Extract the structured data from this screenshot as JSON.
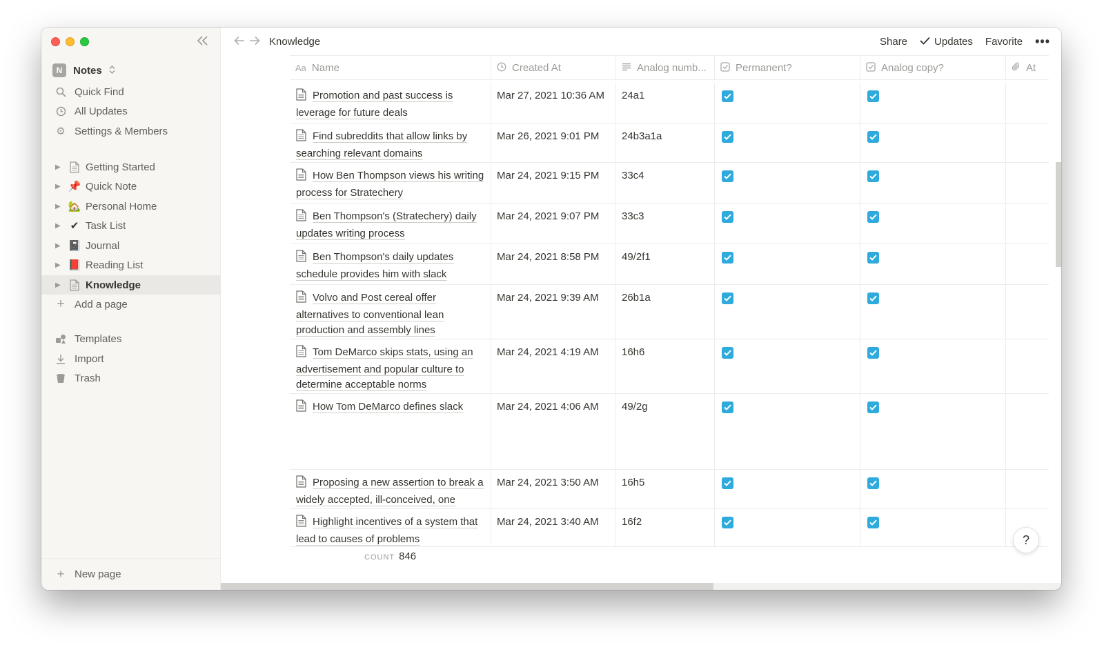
{
  "sidebar": {
    "workspace": {
      "badge": "N",
      "name": "Notes",
      "caret": "⌃"
    },
    "top_items": [
      {
        "label": "Quick Find",
        "icon": "search-icon"
      },
      {
        "label": "All Updates",
        "icon": "clock-icon"
      },
      {
        "label": "Settings & Members",
        "icon": "gear-icon"
      }
    ],
    "pages": [
      {
        "label": "Getting Started",
        "icon": "📄"
      },
      {
        "label": "Quick Note",
        "icon": "📌"
      },
      {
        "label": "Personal Home",
        "icon": "🏡"
      },
      {
        "label": "Task List",
        "icon": "✔️"
      },
      {
        "label": "Journal",
        "icon": "📓"
      },
      {
        "label": "Reading List",
        "icon": "📕"
      },
      {
        "label": "Knowledge",
        "icon": "📄"
      }
    ],
    "add_page": "Add a page",
    "bottom_items": [
      {
        "label": "Templates",
        "icon": "templates-icon"
      },
      {
        "label": "Import",
        "icon": "import-icon"
      },
      {
        "label": "Trash",
        "icon": "trash-icon"
      }
    ],
    "new_page": "New page"
  },
  "topbar": {
    "breadcrumb": "Knowledge",
    "share": "Share",
    "updates": "Updates",
    "favorite": "Favorite",
    "more": "•••"
  },
  "table": {
    "columns": [
      {
        "label": "Name",
        "icon": "Aa"
      },
      {
        "label": "Created At",
        "icon": "clock-icon"
      },
      {
        "label": "Analog numb...",
        "icon": "text-icon"
      },
      {
        "label": "Permanent?",
        "icon": "checkbox-icon"
      },
      {
        "label": "Analog copy?",
        "icon": "checkbox-icon"
      },
      {
        "label": "At",
        "icon": "paperclip-icon"
      }
    ],
    "rows": [
      {
        "name": "Promotion and past success is leverage for future deals",
        "created": "Mar 27, 2021 10:36 AM",
        "analog": "24a1",
        "permanent": true,
        "copy": true
      },
      {
        "name": "Find subreddits that allow links by searching relevant domains",
        "created": "Mar 26, 2021 9:01 PM",
        "analog": "24b3a1a",
        "permanent": true,
        "copy": true
      },
      {
        "name": "How Ben Thompson views his writing process for Stratechery",
        "created": "Mar 24, 2021 9:15 PM",
        "analog": "33c4",
        "permanent": true,
        "copy": true
      },
      {
        "name": "Ben Thompson's (Stratechery) daily updates writing process",
        "created": "Mar 24, 2021 9:07 PM",
        "analog": "33c3",
        "permanent": true,
        "copy": true
      },
      {
        "name": "Ben Thompson's daily updates schedule provides him with slack",
        "created": "Mar 24, 2021 8:58 PM",
        "analog": "49/2f1",
        "permanent": true,
        "copy": true
      },
      {
        "name": "Volvo and Post cereal offer alternatives to conventional lean production and assembly lines",
        "created": "Mar 24, 2021 9:39 AM",
        "analog": "26b1a",
        "permanent": true,
        "copy": true
      },
      {
        "name": "Tom DeMarco skips stats, using an advertisement and popular culture to determine acceptable norms",
        "created": "Mar 24, 2021 4:19 AM",
        "analog": "16h6",
        "permanent": true,
        "copy": true
      },
      {
        "name": "How Tom DeMarco defines slack",
        "created": "Mar 24, 2021 4:06 AM",
        "analog": "49/2g",
        "permanent": true,
        "copy": true
      },
      {
        "name": "Proposing a new assertion to break a widely accepted, ill-conceived, one",
        "created": "Mar 24, 2021 3:50 AM",
        "analog": "16h5",
        "permanent": true,
        "copy": true
      },
      {
        "name": "Highlight incentives of a system that lead to causes of problems",
        "created": "Mar 24, 2021 3:40 AM",
        "analog": "16f2",
        "permanent": true,
        "copy": true
      }
    ],
    "count_label": "COUNT",
    "count_value": "846"
  },
  "help": "?",
  "colors": {
    "checkbox": "#2eaadc",
    "sidebar_bg": "#f7f6f3",
    "text": "#37352f",
    "muted": "#9b9a97"
  }
}
